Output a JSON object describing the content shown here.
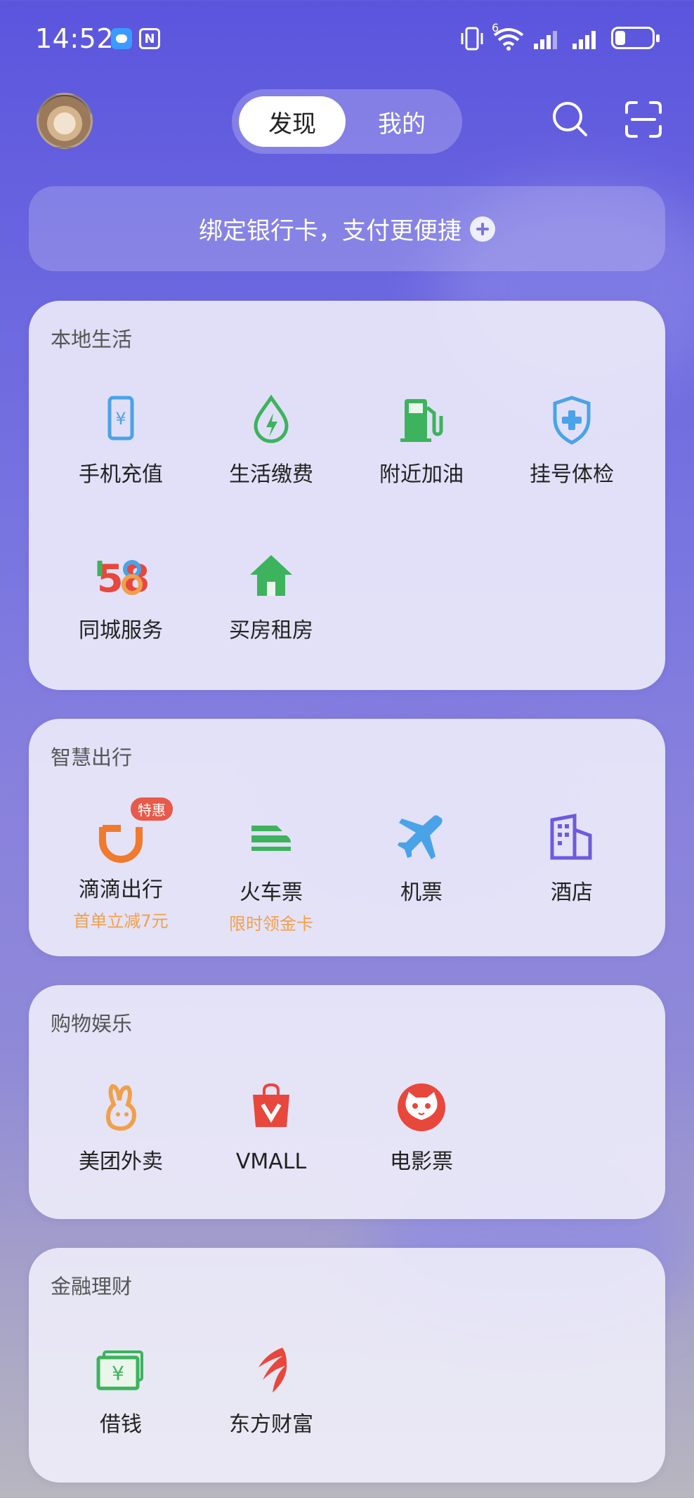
{
  "status_bar": {
    "time": "14:52",
    "signal_label": "6"
  },
  "header": {
    "tabs": [
      {
        "label": "发现",
        "active": true
      },
      {
        "label": "我的",
        "active": false
      }
    ],
    "search_icon": "search-icon",
    "scan_icon": "scan-icon"
  },
  "banner": {
    "text": "绑定银行卡，支付更便捷"
  },
  "sections": {
    "local": {
      "title": "本地生活",
      "items": [
        {
          "label": "手机充值",
          "icon": "phone-recharge-icon"
        },
        {
          "label": "生活缴费",
          "icon": "utility-payment-icon"
        },
        {
          "label": "附近加油",
          "icon": "gas-station-icon"
        },
        {
          "label": "挂号体检",
          "icon": "medical-shield-icon"
        },
        {
          "label": "同城服务",
          "icon": "58-logo-icon",
          "logo_text": "58"
        },
        {
          "label": "买房租房",
          "icon": "house-icon"
        }
      ]
    },
    "travel": {
      "title": "智慧出行",
      "items": [
        {
          "label": "滴滴出行",
          "sub": "首单立减7元",
          "badge": "特惠",
          "icon": "didi-icon"
        },
        {
          "label": "火车票",
          "sub": "限时领金卡",
          "icon": "train-icon"
        },
        {
          "label": "机票",
          "icon": "airplane-icon"
        },
        {
          "label": "酒店",
          "icon": "hotel-icon"
        }
      ]
    },
    "shopping": {
      "title": "购物娱乐",
      "items": [
        {
          "label": "美团外卖",
          "icon": "meituan-icon"
        },
        {
          "label": "VMALL",
          "icon": "vmall-bag-icon"
        },
        {
          "label": "电影票",
          "icon": "movie-cat-icon"
        }
      ]
    },
    "finance": {
      "title": "金融理财",
      "items": [
        {
          "label": "借钱",
          "icon": "money-icon"
        },
        {
          "label": "东方财富",
          "icon": "eastmoney-icon"
        }
      ]
    }
  },
  "colors": {
    "accent": "#5b55de",
    "promo": "#f0a04b",
    "badge": "#e85a4a"
  }
}
